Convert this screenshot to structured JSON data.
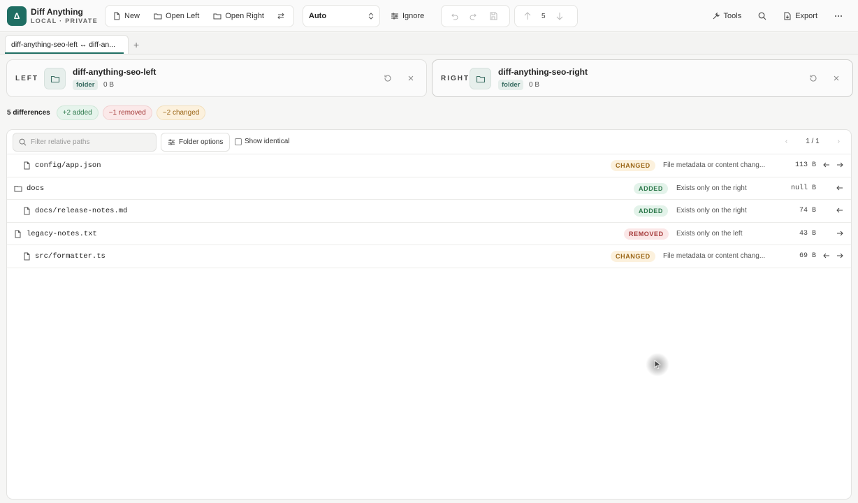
{
  "brand": {
    "logo_letter": "Δ",
    "name": "Diff Anything",
    "subtitle": "LOCAL · PRIVATE"
  },
  "toolbar": {
    "new_label": "New",
    "open_left_label": "Open Left",
    "open_right_label": "Open Right",
    "mode_value": "Auto",
    "ignore_label": "Ignore",
    "nav_count": "5",
    "tools_label": "Tools",
    "export_label": "Export"
  },
  "tabs": [
    {
      "label": "diff-anything-seo-left ↔ diff-an..."
    }
  ],
  "left": {
    "label": "LEFT",
    "name": "diff-anything-seo-left",
    "kind": "folder",
    "size": "0 B"
  },
  "right": {
    "label": "RIGHT",
    "name": "diff-anything-seo-right",
    "kind": "folder",
    "size": "0 B"
  },
  "summary": {
    "count_text": "5 differences",
    "added": "+2 added",
    "removed": "−1 removed",
    "changed": "~2 changed"
  },
  "filter": {
    "placeholder": "Filter relative paths",
    "folder_options_label": "Folder options",
    "show_identical_label": "Show identical",
    "page": "1 / 1"
  },
  "rows": [
    {
      "path": "config/app.json",
      "type": "file",
      "status": "CHANGED",
      "desc": "File metadata or content chang...",
      "size": "113 B"
    },
    {
      "path": "docs",
      "type": "folder",
      "status": "ADDED",
      "desc": "Exists only on the right",
      "size": "null B"
    },
    {
      "path": "docs/release-notes.md",
      "type": "file",
      "status": "ADDED",
      "desc": "Exists only on the right",
      "size": "74 B"
    },
    {
      "path": "legacy-notes.txt",
      "type": "file",
      "status": "REMOVED",
      "desc": "Exists only on the left",
      "size": "43 B"
    },
    {
      "path": "src/formatter.ts",
      "type": "file",
      "status": "CHANGED",
      "desc": "File metadata or content chang...",
      "size": "69 B"
    }
  ],
  "colors": {
    "accent": "#1f6e63",
    "added": "#2f7a4d",
    "removed": "#a53a3a",
    "changed": "#9a6516"
  },
  "icons": [
    "file-icon",
    "folder-icon",
    "search-icon",
    "undo-icon",
    "redo-icon",
    "save-icon",
    "arrow-up-icon",
    "arrow-down-icon",
    "swap-icon",
    "tools-icon",
    "export-icon",
    "more-icon",
    "refresh-icon",
    "close-icon",
    "arrow-left-icon",
    "arrow-right-icon"
  ]
}
